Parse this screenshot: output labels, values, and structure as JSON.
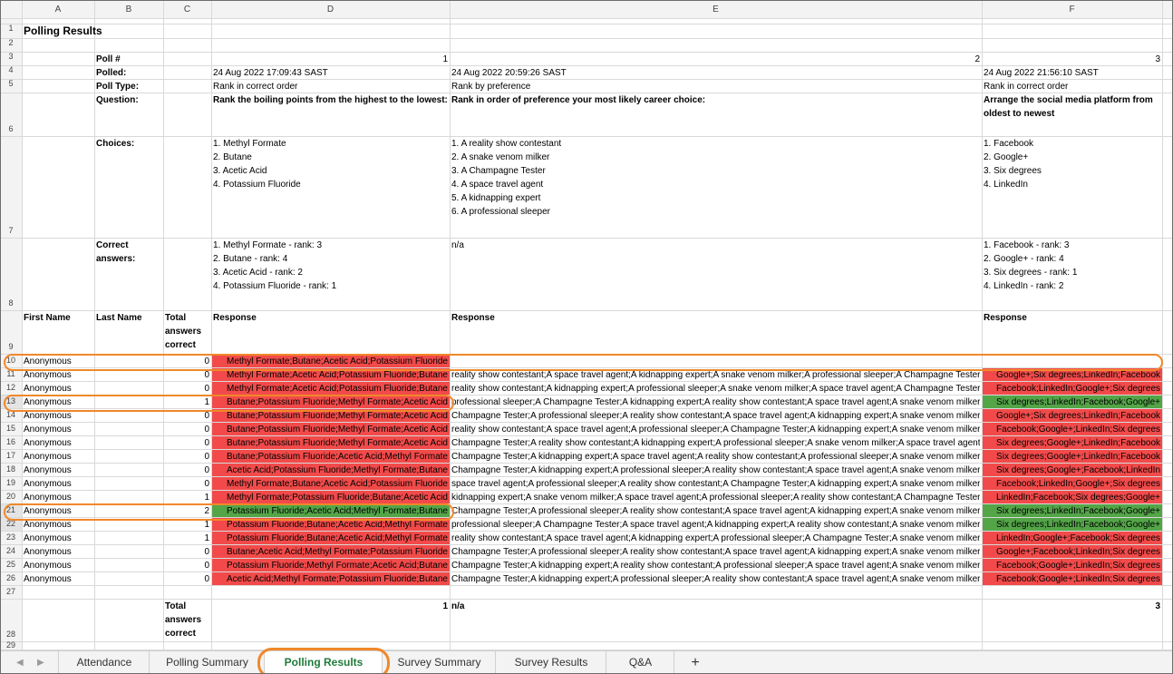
{
  "columns": [
    "A",
    "B",
    "C",
    "D",
    "E",
    "F"
  ],
  "row_numbers": [
    "1",
    "2",
    "3",
    "4",
    "5",
    "6",
    "7",
    "8",
    "9",
    "10",
    "11",
    "12",
    "13",
    "14",
    "15",
    "16",
    "17",
    "18",
    "19",
    "20",
    "21",
    "22",
    "23",
    "24",
    "25",
    "26",
    "27",
    "28",
    "29"
  ],
  "title": "Polling Results",
  "labels": {
    "poll_num": "Poll #",
    "polled": "Polled:",
    "poll_type": "Poll Type:",
    "question": "Question:",
    "choices": "Choices:",
    "correct_1": "Correct",
    "correct_2": "answers:",
    "first_name": "First Name",
    "last_name": "Last Name",
    "total_1": "Total",
    "total_2": "answers",
    "total_3": "correct"
  },
  "polls": [
    {
      "num": "1",
      "polled": "24 Aug 2022 17:09:43 SAST",
      "type": "Rank in correct order",
      "question": [
        "Rank the boiling points from the highest to the lowest:"
      ],
      "choices": [
        "1. Methyl Formate",
        "2. Butane",
        "3. Acetic Acid",
        "4. Potassium Fluoride"
      ],
      "correct": [
        "1. Methyl Formate - rank: 3",
        "2. Butane - rank: 4",
        "3. Acetic Acid - rank: 2",
        "4. Potassium Fluoride - rank: 1"
      ],
      "response_header": "Response",
      "total": "1"
    },
    {
      "num": "2",
      "polled": "24 Aug 2022 20:59:26 SAST",
      "type": "Rank by preference",
      "question": [
        "Rank in order of preference your most likely career choice:"
      ],
      "choices": [
        "1. A reality show contestant",
        "2. A snake venom milker",
        "3. A Champagne Tester",
        "4. A space travel agent",
        "5. A kidnapping expert",
        "6. A professional sleeper"
      ],
      "correct": [
        "n/a"
      ],
      "response_header": "Response",
      "total": "n/a"
    },
    {
      "num": "3",
      "polled": "24 Aug 2022 21:56:10 SAST",
      "type": "Rank in correct order",
      "question": [
        "Arrange the social media platform from",
        "oldest to newest"
      ],
      "choices": [
        "1. Facebook",
        "2. Google+",
        "3. Six degrees",
        "4. LinkedIn"
      ],
      "correct": [
        "1. Facebook - rank: 3",
        "2. Google+ - rank: 4",
        "3. Six degrees - rank: 1",
        "4. LinkedIn - rank: 2"
      ],
      "response_header": "Response",
      "total": "3"
    }
  ],
  "rows": [
    {
      "n": "10",
      "name": "Anonymous",
      "total": "0",
      "d": "Methyl Formate;Butane;Acetic Acid;Potassium Fluoride",
      "dc": "red",
      "e": "",
      "f": "",
      "fc": ""
    },
    {
      "n": "11",
      "name": "Anonymous",
      "total": "0",
      "d": "Methyl Formate;Acetic Acid;Potassium Fluoride;Butane",
      "dc": "red",
      "e": "reality show contestant;A space travel agent;A kidnapping expert;A snake venom milker;A professional sleeper;A Champagne Tester",
      "f": "Google+;Six degrees;LinkedIn;Facebook",
      "fc": "red"
    },
    {
      "n": "12",
      "name": "Anonymous",
      "total": "0",
      "d": "Methyl Formate;Acetic Acid;Potassium Fluoride;Butane",
      "dc": "red",
      "e": "reality show contestant;A kidnapping expert;A professional sleeper;A snake venom milker;A space travel agent;A Champagne Tester",
      "f": "Facebook;LinkedIn;Google+;Six degrees",
      "fc": "red"
    },
    {
      "n": "13",
      "name": "Anonymous",
      "total": "1",
      "d": "Butane;Potassium Fluoride;Methyl Formate;Acetic Acid",
      "dc": "red",
      "e": "professional sleeper;A Champagne Tester;A kidnapping expert;A reality show contestant;A space travel agent;A snake venom milker",
      "f": "Six degrees;LinkedIn;Facebook;Google+",
      "fc": "green"
    },
    {
      "n": "14",
      "name": "Anonymous",
      "total": "0",
      "d": "Butane;Potassium Fluoride;Methyl Formate;Acetic Acid",
      "dc": "red",
      "e": "Champagne Tester;A professional sleeper;A reality show contestant;A space travel agent;A kidnapping expert;A snake venom milker",
      "f": "Google+;Six degrees;LinkedIn;Facebook",
      "fc": "red"
    },
    {
      "n": "15",
      "name": "Anonymous",
      "total": "0",
      "d": "Butane;Potassium Fluoride;Methyl Formate;Acetic Acid",
      "dc": "red",
      "e": "reality show contestant;A space travel agent;A professional sleeper;A Champagne Tester;A kidnapping expert;A snake venom milker",
      "f": "Facebook;Google+;LinkedIn;Six degrees",
      "fc": "red"
    },
    {
      "n": "16",
      "name": "Anonymous",
      "total": "0",
      "d": "Butane;Potassium Fluoride;Methyl Formate;Acetic Acid",
      "dc": "red",
      "e": "Champagne Tester;A reality show contestant;A kidnapping expert;A professional sleeper;A snake venom milker;A space travel agent",
      "f": "Six degrees;Google+;LinkedIn;Facebook",
      "fc": "red"
    },
    {
      "n": "17",
      "name": "Anonymous",
      "total": "0",
      "d": "Butane;Potassium Fluoride;Acetic Acid;Methyl Formate",
      "dc": "red",
      "e": "Champagne Tester;A kidnapping expert;A space travel agent;A reality show contestant;A professional sleeper;A snake venom milker",
      "f": "Six degrees;Google+;LinkedIn;Facebook",
      "fc": "red"
    },
    {
      "n": "18",
      "name": "Anonymous",
      "total": "0",
      "d": "Acetic Acid;Potassium Fluoride;Methyl Formate;Butane",
      "dc": "red",
      "e": "Champagne Tester;A kidnapping expert;A professional sleeper;A reality show contestant;A space travel agent;A snake venom milker",
      "f": "Six degrees;Google+;Facebook;LinkedIn",
      "fc": "red"
    },
    {
      "n": "19",
      "name": "Anonymous",
      "total": "0",
      "d": "Methyl Formate;Butane;Acetic Acid;Potassium Fluoride",
      "dc": "red",
      "e": "space travel agent;A professional sleeper;A reality show contestant;A Champagne Tester;A kidnapping expert;A snake venom milker",
      "f": "Facebook;LinkedIn;Google+;Six degrees",
      "fc": "red"
    },
    {
      "n": "20",
      "name": "Anonymous",
      "total": "1",
      "d": "Methyl Formate;Potassium Fluoride;Butane;Acetic Acid",
      "dc": "red",
      "e": "kidnapping expert;A snake venom milker;A space travel agent;A professional sleeper;A reality show contestant;A Champagne Tester",
      "f": "LinkedIn;Facebook;Six degrees;Google+",
      "fc": "red"
    },
    {
      "n": "21",
      "name": "Anonymous",
      "total": "2",
      "d": "Potassium Fluoride;Acetic Acid;Methyl Formate;Butane",
      "dc": "green",
      "e": "Champagne Tester;A professional sleeper;A reality show contestant;A space travel agent;A kidnapping expert;A snake venom milker",
      "f": "Six degrees;LinkedIn;Facebook;Google+",
      "fc": "green"
    },
    {
      "n": "22",
      "name": "Anonymous",
      "total": "1",
      "d": "Potassium Fluoride;Butane;Acetic Acid;Methyl Formate",
      "dc": "red",
      "e": "professional sleeper;A Champagne Tester;A space travel agent;A kidnapping expert;A reality show contestant;A snake venom milker",
      "f": "Six degrees;LinkedIn;Facebook;Google+",
      "fc": "green"
    },
    {
      "n": "23",
      "name": "Anonymous",
      "total": "1",
      "d": "Potassium Fluoride;Butane;Acetic Acid;Methyl Formate",
      "dc": "red",
      "e": "reality show contestant;A space travel agent;A kidnapping expert;A professional sleeper;A Champagne Tester;A snake venom milker",
      "f": "LinkedIn;Google+;Facebook;Six degrees",
      "fc": "red"
    },
    {
      "n": "24",
      "name": "Anonymous",
      "total": "0",
      "d": "Butane;Acetic Acid;Methyl Formate;Potassium Fluoride",
      "dc": "red",
      "e": "Champagne Tester;A professional sleeper;A reality show contestant;A space travel agent;A kidnapping expert;A snake venom milker",
      "f": "Google+;Facebook;LinkedIn;Six degrees",
      "fc": "red"
    },
    {
      "n": "25",
      "name": "Anonymous",
      "total": "0",
      "d": "Potassium Fluoride;Methyl Formate;Acetic Acid;Butane",
      "dc": "red",
      "e": "Champagne Tester;A kidnapping expert;A reality show contestant;A professional sleeper;A space travel agent;A snake venom milker",
      "f": "Facebook;Google+;LinkedIn;Six degrees",
      "fc": "red"
    },
    {
      "n": "26",
      "name": "Anonymous",
      "total": "0",
      "d": "Acetic Acid;Methyl Formate;Potassium Fluoride;Butane",
      "dc": "red",
      "e": "Champagne Tester;A kidnapping expert;A professional sleeper;A reality show contestant;A space travel agent;A snake venom milker",
      "f": "Facebook;Google+;LinkedIn;Six degrees",
      "fc": "red"
    }
  ],
  "tabs": [
    "Attendance",
    "Polling Summary",
    "Polling Results",
    "Survey Summary",
    "Survey Results",
    "Q&A"
  ],
  "add_tab": "+",
  "nav": {
    "prev": "◀",
    "next": "▶"
  },
  "colors": {
    "incorrect": "#f24a4a",
    "correct": "#53a548",
    "highlight": "#f0882a",
    "active_tab": "#1f7a3a"
  }
}
